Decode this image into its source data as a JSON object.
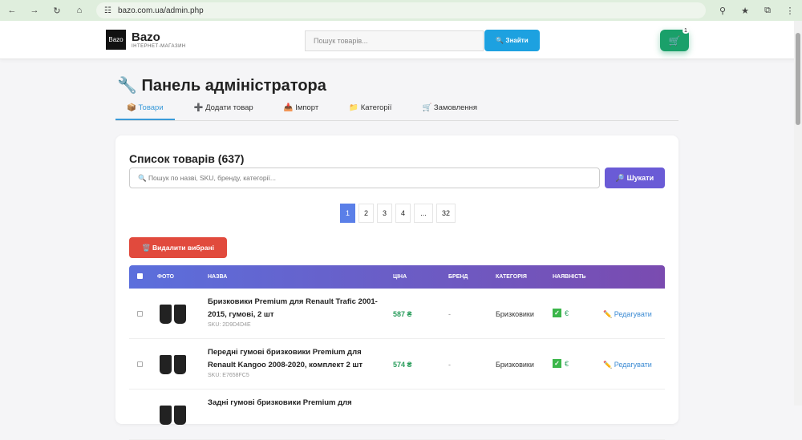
{
  "browser": {
    "url": "bazo.com.ua/admin.php"
  },
  "header": {
    "logo_text": "Bazo",
    "brand": "Bazo",
    "brand_sub": "ІНТЕРНЕТ-МАГАЗИН",
    "search_placeholder": "Пошук товарів...",
    "search_button": "🔍 Знайти",
    "cart_count": "1"
  },
  "page": {
    "title": "🔧 Панель адміністратора",
    "tabs": [
      {
        "label": "Товари",
        "icon": "📦"
      },
      {
        "label": "Додати товар",
        "icon": "➕"
      },
      {
        "label": "Імпорт",
        "icon": "📥"
      },
      {
        "label": "Категорії",
        "icon": "📁"
      },
      {
        "label": "Замовлення",
        "icon": "🛒"
      }
    ]
  },
  "products": {
    "title": "Список товарів (637)",
    "search_placeholder": "🔍 Пошук по назві, SKU, бренду, категорії...",
    "search_button": "🔎 Шукати",
    "pages": [
      "1",
      "2",
      "3",
      "4",
      "...",
      "32"
    ],
    "delete_button": "🗑️ Видалити вибрані",
    "columns": {
      "photo": "ФОТО",
      "name": "НАЗВА",
      "price": "ЦІНА",
      "brand": "БРЕНД",
      "category": "КАТЕГОРІЯ",
      "stock": "НАЯВНІСТЬ"
    },
    "rows": [
      {
        "name": "Бризковики Premium для Renault Trafic 2001-2015, гумові, 2 шт",
        "sku": "SKU: 2D9D4D4E",
        "price": "587 ₴",
        "brand": "-",
        "category": "Бризковики",
        "stock_check": "✓",
        "stock": "€",
        "edit": "✏️ Редагувати"
      },
      {
        "name": "Передні гумові бризковики Premium для Renault Kangoo 2008-2020, комплект 2 шт",
        "sku": "SKU: E7658FC5",
        "price": "574 ₴",
        "brand": "-",
        "category": "Бризковики",
        "stock_check": "✓",
        "stock": "€",
        "edit": "✏️ Редагувати"
      },
      {
        "name": "Задні гумові бризковики Premium для",
        "sku": "",
        "price": "",
        "brand": "",
        "category": "",
        "stock_check": "",
        "stock": "",
        "edit": ""
      }
    ]
  }
}
